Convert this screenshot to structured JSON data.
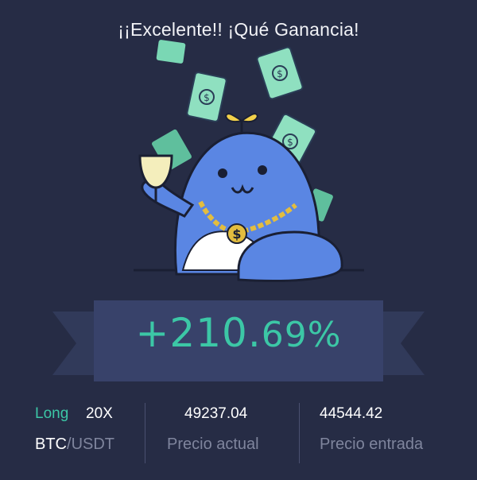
{
  "header": {
    "title": "¡¡Excelente!! ¡Qué Ganancia!"
  },
  "result": {
    "pnl_main": "+210.",
    "pnl_decimals": "69%"
  },
  "position": {
    "direction": "Long",
    "leverage": "20X",
    "base": "BTC",
    "separator": "/",
    "quote": "USDT"
  },
  "prices": {
    "current_value": "49237.04",
    "current_label": "Precio actual",
    "entry_value": "44544.42",
    "entry_label": "Precio entrada"
  },
  "colors": {
    "background": "#262c45",
    "accent_green": "#3cc7a6",
    "mascot_blue": "#5a86e3",
    "money_green": "#7ad7b4",
    "muted_text": "#7f859d"
  },
  "icons": {
    "mascot": "whale-mascot-illustration",
    "money": "dollar-bill-icon",
    "chain": "gold-dollar-chain-icon",
    "glass": "champagne-glass-icon"
  }
}
